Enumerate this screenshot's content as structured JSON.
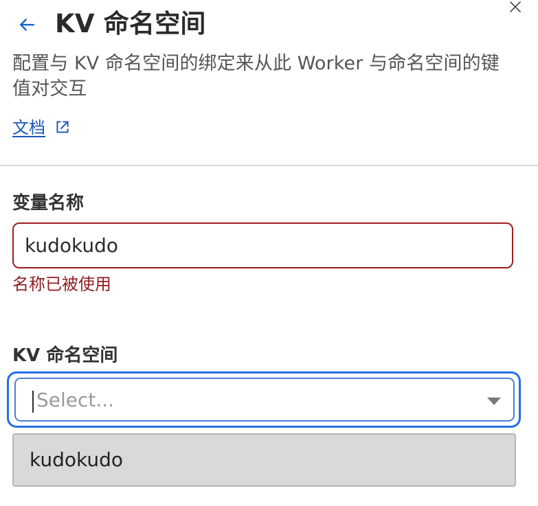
{
  "header": {
    "back_icon": "arrow-left-icon",
    "title": "KV 命名空间",
    "close_icon": "close-icon",
    "description": "配置与 KV 命名空间的绑定来从此 Worker 与命名空间的键值对交互",
    "docs_label": "文档",
    "docs_icon": "external-link-icon"
  },
  "form": {
    "variable_name": {
      "label": "变量名称",
      "value": "kudokudo",
      "error": "名称已被使用"
    },
    "namespace": {
      "label": "KV 命名空间",
      "placeholder": "Select...",
      "dropdown_icon": "chevron-down-icon",
      "options": [
        {
          "label": "kudokudo"
        }
      ]
    }
  },
  "colors": {
    "accent": "#1264c8",
    "error": "#9f1c1c",
    "focus": "#2170e8",
    "menu_background": "#d9d9d9"
  }
}
